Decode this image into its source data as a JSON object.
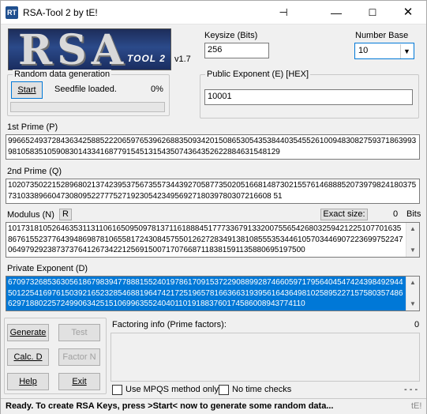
{
  "window": {
    "title": "RSA-Tool 2 by tE!",
    "pin_glyph": "⊣",
    "minimize_glyph": "—",
    "maximize_glyph": "☐",
    "close_glyph": "✕",
    "icon_glyph": "RT"
  },
  "logo": {
    "text": "RSA",
    "subtext": "TOOL 2",
    "version": "v1.7"
  },
  "keysize": {
    "label": "Keysize (Bits)",
    "value": "256"
  },
  "number_base": {
    "label": "Number Base",
    "value": "10"
  },
  "random": {
    "label": "Random data generation",
    "start": "Start",
    "status": "Seedfile loaded.",
    "percent": "0%",
    "progress": 0
  },
  "public_exponent": {
    "label": "Public Exponent (E) [HEX]",
    "value": "10001"
  },
  "prime1": {
    "label": "1st Prime (P)",
    "value": "99665249372843634258852220659765396268835093420150865305435384403545526100948308275937186399398105835105908301433416877915451315435074364352622884631548129"
  },
  "prime2": {
    "label": "2nd Prime (Q)",
    "value": "102073502215289680213742395375673557344392705877350205166814873021557614688852073979824180375731033896604730809522777527192305423495692718039780307216608 51"
  },
  "modulus": {
    "label": "Modulus (N)",
    "r_button": "R",
    "exact_size_button": "Exact size:",
    "size_value": "0",
    "bits_label": "Bits",
    "value": "10173181052646353113110616509509781371161888451777336791332007556542680325942122510770163586761552377643948698781065581724308457550126272834913810855535344610570344690722369975224706497929238737376412673422125691500717076687118381591135880695197500"
  },
  "private_exponent": {
    "label": "Private Exponent (D)",
    "value": "67097326853630561867983947788815524019786170915372290889928746605971795640454742439849294450122541697615039216523285468819647421725196578166366319395616436498102589522715758035748662971880225724990634251510699635524040110191883760174586008943774110"
  },
  "buttons": {
    "generate": "Generate",
    "test": "Test",
    "calc_d": "Calc. D",
    "factor_n": "Factor N",
    "help": "Help",
    "exit": "Exit"
  },
  "factoring": {
    "label": "Factoring info (Prime factors):",
    "count": "0",
    "mpqs_label": "Use MPQS method only",
    "nochecks_label": "No time checks",
    "dashes": "- - -"
  },
  "status": {
    "text": "Ready. To create RSA Keys, press >Start< now to generate some random data...",
    "tag": "tE!"
  }
}
